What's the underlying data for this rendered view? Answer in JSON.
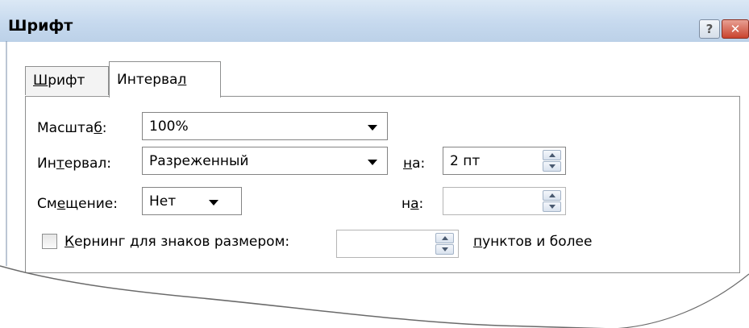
{
  "window": {
    "title": "Шрифт",
    "help_button": "?",
    "close_button": "✕"
  },
  "tabs": [
    {
      "pre": "",
      "u": "Ш",
      "post": "рифт",
      "active": false
    },
    {
      "pre": "Интерва",
      "u": "л",
      "post": "",
      "active": true
    }
  ],
  "fields": {
    "scale": {
      "label_pre": "Масшта",
      "label_u": "б",
      "label_post": ":",
      "value": "100%"
    },
    "interval": {
      "label_pre": "Ин",
      "label_u": "т",
      "label_post": "ервал:",
      "value": "Разреженный"
    },
    "interval_by": {
      "label_pre": "",
      "label_u": "н",
      "label_post": "а:",
      "value": "2 пт"
    },
    "offset": {
      "label_pre": "См",
      "label_u": "е",
      "label_post": "щение:",
      "value": "Нет"
    },
    "offset_by": {
      "label_pre": "н",
      "label_u": "а",
      "label_post": ":",
      "value": ""
    },
    "kerning": {
      "label_pre": "",
      "label_u": "К",
      "label_post": "ернинг для знаков размером:",
      "value": "",
      "checked": false
    },
    "kerning_suffix": {
      "label_pre": "",
      "label_u": "п",
      "label_post": "унктов и более"
    }
  },
  "icons": {
    "dropdown": "chevron-down-icon",
    "spin": "spinner-icon",
    "help": "help-icon",
    "close": "close-icon"
  },
  "colors": {
    "titlebar": "#c6d9ee",
    "close_button": "#c9432e"
  }
}
